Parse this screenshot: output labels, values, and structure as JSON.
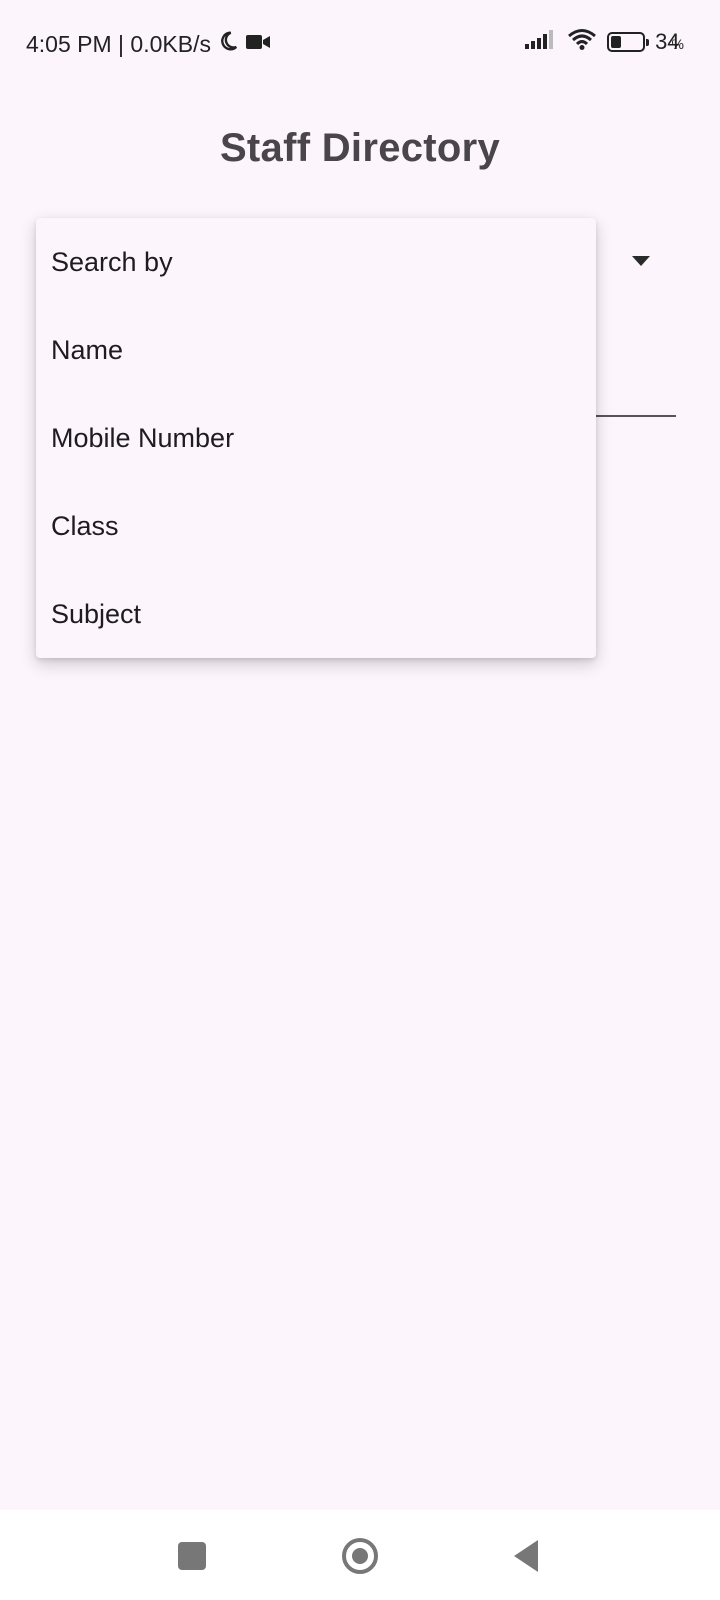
{
  "status_bar": {
    "time_speed": "4:05 PM | 0.0KB/s",
    "battery_percent": "34",
    "battery_percent_suffix": "%",
    "battery_level": 0.34,
    "icons": [
      "moon-icon",
      "video-camera-icon",
      "signal-icon",
      "wifi-icon",
      "battery-icon"
    ]
  },
  "header": {
    "title": "Staff Directory"
  },
  "dropdown": {
    "items": [
      {
        "label": "Search by"
      },
      {
        "label": "Name"
      },
      {
        "label": "Mobile Number"
      },
      {
        "label": "Class"
      },
      {
        "label": "Subject"
      }
    ]
  },
  "nav_bar": {
    "icons": [
      "recents-square-icon",
      "home-circle-icon",
      "back-triangle-icon"
    ]
  },
  "colors": {
    "background": "#fcf5fc",
    "title": "#4a454b",
    "text": "#1f1b20"
  }
}
